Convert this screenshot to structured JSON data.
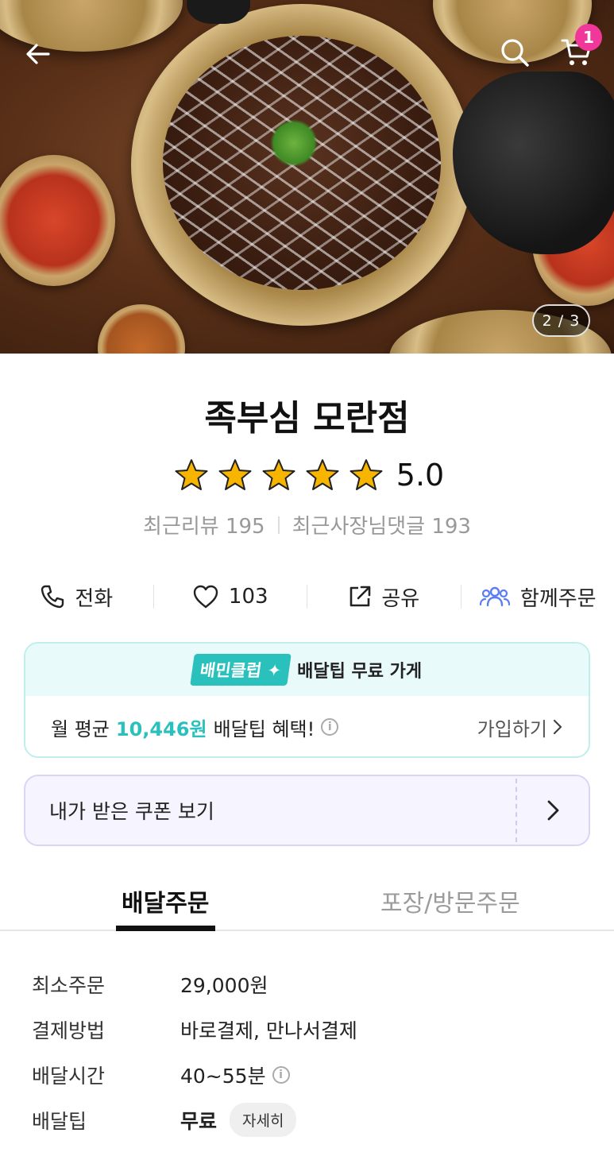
{
  "hero": {
    "pager": "2 / 3",
    "cart_count": "1",
    "icons": [
      "back-arrow-icon",
      "search-icon",
      "cart-icon"
    ]
  },
  "store": {
    "name": "족부심 모란점",
    "rating": 5.0,
    "rating_text": "5.0",
    "recent_reviews": "최근리뷰 195",
    "owner_replies": "최근사장님댓글 193"
  },
  "actions": [
    {
      "label": "전화",
      "icon": "phone-icon"
    },
    {
      "label": "103",
      "icon": "heart-icon"
    },
    {
      "label": "공유",
      "icon": "share-icon"
    },
    {
      "label": "함께주문",
      "icon": "group-icon"
    }
  ],
  "club": {
    "badge": "배민클럽",
    "headline": "배달팁 무료 가게",
    "prefix": "월 평균",
    "amount": "10,446원",
    "suffix": "배달팁 혜택!",
    "join_label": "가입하기",
    "accent": "#2ac1bc"
  },
  "coupon": {
    "label": "내가 받은 쿠폰 보기"
  },
  "tabs": [
    {
      "label": "배달주문",
      "active": true
    },
    {
      "label": "포장/방문주문",
      "active": false
    }
  ],
  "info": {
    "min_order": {
      "label": "최소주문",
      "value": "29,000원"
    },
    "payment": {
      "label": "결제방법",
      "value": "바로결제, 만나서결제"
    },
    "delivery_time": {
      "label": "배달시간",
      "value": "40~55분"
    },
    "delivery_tip": {
      "label": "배달팁",
      "value": "무료",
      "detail": "자세히"
    }
  },
  "colors": {
    "badge": "#f0389a",
    "star": "#f7b500",
    "group_icon": "#5b7cf5"
  }
}
